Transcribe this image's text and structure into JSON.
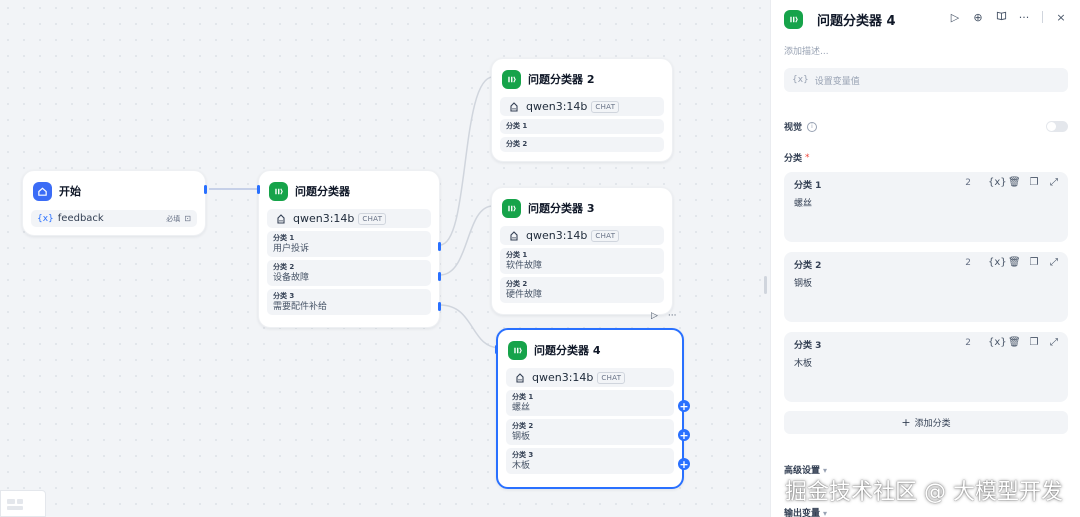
{
  "canvas": {
    "start_node": {
      "title": "开始",
      "variable": {
        "icon": "{x}",
        "name": "feedback",
        "tag": "必填",
        "type_icon": "⊡"
      }
    },
    "classifier_1": {
      "title": "问题分类器",
      "model": "qwen3:14b",
      "model_badge": "CHAT",
      "classes": [
        {
          "label": "分类 1",
          "text": "用户投诉"
        },
        {
          "label": "分类 2",
          "text": "设备故障"
        },
        {
          "label": "分类 3",
          "text": "需要配件补给"
        }
      ]
    },
    "classifier_2": {
      "title": "问题分类器 2",
      "model": "qwen3:14b",
      "model_badge": "CHAT",
      "classes": [
        {
          "label": "分类 1",
          "text": ""
        },
        {
          "label": "分类 2",
          "text": ""
        }
      ]
    },
    "classifier_3": {
      "title": "问题分类器 3",
      "model": "qwen3:14b",
      "model_badge": "CHAT",
      "classes": [
        {
          "label": "分类 1",
          "text": "软件故障"
        },
        {
          "label": "分类 2",
          "text": "硬件故障"
        }
      ]
    },
    "classifier_4": {
      "title": "问题分类器 4",
      "model": "qwen3:14b",
      "model_badge": "CHAT",
      "toolbar": {
        "run": "▷",
        "more": "···"
      },
      "classes": [
        {
          "label": "分类 1",
          "text": "螺丝"
        },
        {
          "label": "分类 2",
          "text": "钢板"
        },
        {
          "label": "分类 3",
          "text": "木板"
        }
      ]
    }
  },
  "panel": {
    "title": "问题分类器 4",
    "description_placeholder": "添加描述...",
    "set_variable_icon": "{x}",
    "set_variable_placeholder": "设置变量值",
    "vision_label": "视觉",
    "class_section_label": "分类",
    "required_mark": "*",
    "classes": [
      {
        "label": "分类 1",
        "count": "2",
        "text": "螺丝"
      },
      {
        "label": "分类 2",
        "count": "2",
        "text": "钢板"
      },
      {
        "label": "分类 3",
        "count": "2",
        "text": "木板"
      }
    ],
    "add_class_label": "添加分类",
    "advanced_label": "高级设置",
    "output_label": "输出变量"
  },
  "watermark": "掘金技术社区 @ 大模型开发",
  "colors": {
    "accent": "#2970ff",
    "node_icon_green": "#16a34a",
    "start_icon_blue": "#3b6cf6",
    "canvas_bg": "#f2f4f7"
  }
}
